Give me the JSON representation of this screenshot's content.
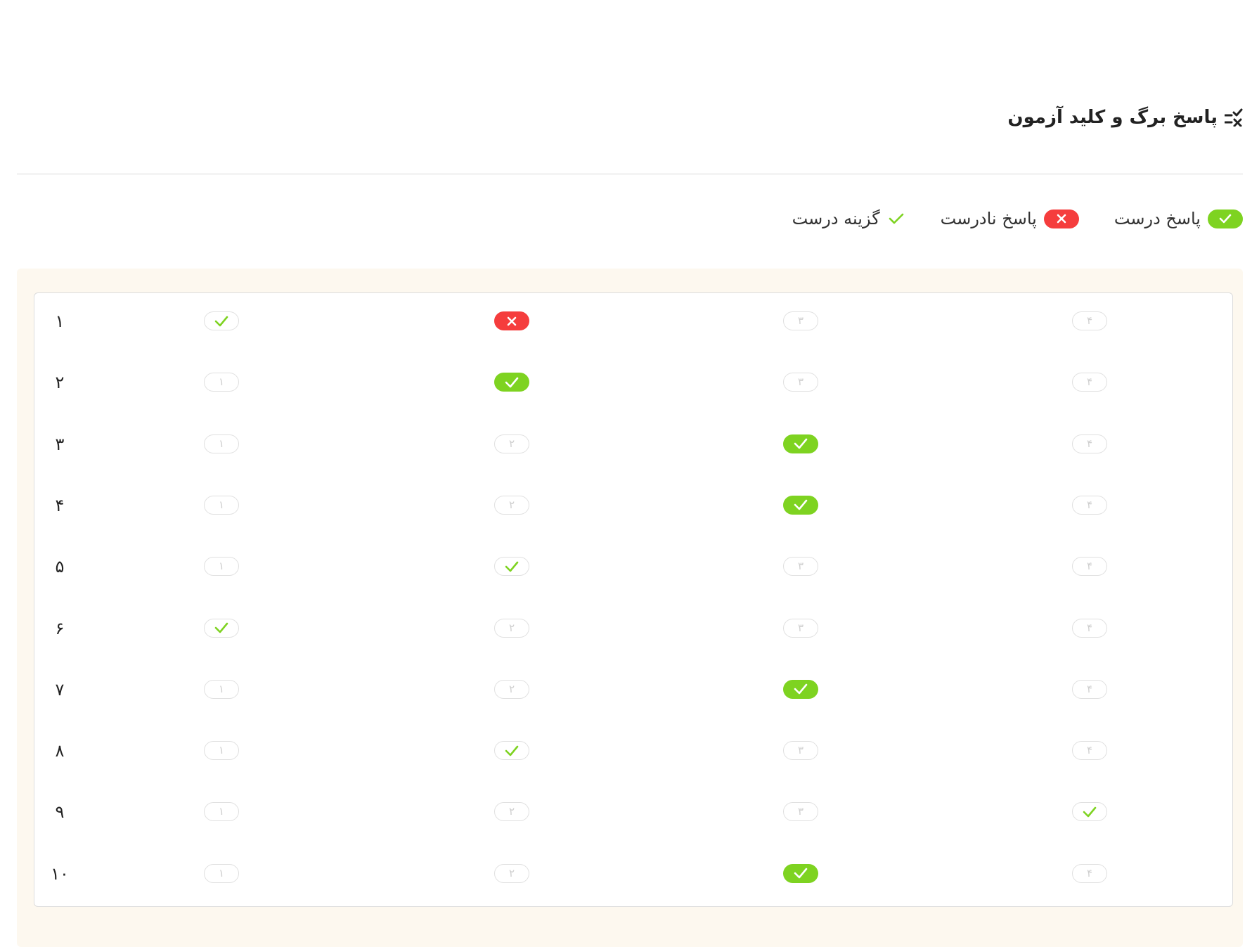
{
  "header": {
    "title": "پاسخ برگ و کلید آزمون",
    "icon": "checklist-icon"
  },
  "legend": [
    {
      "label": "پاسخ درست",
      "type": "correct"
    },
    {
      "label": "پاسخ نادرست",
      "type": "wrong"
    },
    {
      "label": "گزینه درست",
      "type": "key"
    }
  ],
  "colors": {
    "correct": "#7ed321",
    "wrong": "#f53d3d",
    "panel_bg": "#fdf8ef",
    "option_border": "#e0e0e0"
  },
  "answer_sheet": {
    "rows": [
      {
        "q": "۱",
        "options": [
          {
            "label": "۱",
            "state": "key"
          },
          {
            "label": "۲",
            "state": "wrong"
          },
          {
            "label": "۳",
            "state": "empty"
          },
          {
            "label": "۴",
            "state": "empty"
          }
        ]
      },
      {
        "q": "۲",
        "options": [
          {
            "label": "۱",
            "state": "empty"
          },
          {
            "label": "۲",
            "state": "correct"
          },
          {
            "label": "۳",
            "state": "empty"
          },
          {
            "label": "۴",
            "state": "empty"
          }
        ]
      },
      {
        "q": "۳",
        "options": [
          {
            "label": "۱",
            "state": "empty"
          },
          {
            "label": "۲",
            "state": "empty"
          },
          {
            "label": "۳",
            "state": "correct"
          },
          {
            "label": "۴",
            "state": "empty"
          }
        ]
      },
      {
        "q": "۴",
        "options": [
          {
            "label": "۱",
            "state": "empty"
          },
          {
            "label": "۲",
            "state": "empty"
          },
          {
            "label": "۳",
            "state": "correct"
          },
          {
            "label": "۴",
            "state": "empty"
          }
        ]
      },
      {
        "q": "۵",
        "options": [
          {
            "label": "۱",
            "state": "empty"
          },
          {
            "label": "۲",
            "state": "key"
          },
          {
            "label": "۳",
            "state": "empty"
          },
          {
            "label": "۴",
            "state": "empty"
          }
        ]
      },
      {
        "q": "۶",
        "options": [
          {
            "label": "۱",
            "state": "key"
          },
          {
            "label": "۲",
            "state": "empty"
          },
          {
            "label": "۳",
            "state": "empty"
          },
          {
            "label": "۴",
            "state": "empty"
          }
        ]
      },
      {
        "q": "۷",
        "options": [
          {
            "label": "۱",
            "state": "empty"
          },
          {
            "label": "۲",
            "state": "empty"
          },
          {
            "label": "۳",
            "state": "correct"
          },
          {
            "label": "۴",
            "state": "empty"
          }
        ]
      },
      {
        "q": "۸",
        "options": [
          {
            "label": "۱",
            "state": "empty"
          },
          {
            "label": "۲",
            "state": "key"
          },
          {
            "label": "۳",
            "state": "empty"
          },
          {
            "label": "۴",
            "state": "empty"
          }
        ]
      },
      {
        "q": "۹",
        "options": [
          {
            "label": "۱",
            "state": "empty"
          },
          {
            "label": "۲",
            "state": "empty"
          },
          {
            "label": "۳",
            "state": "empty"
          },
          {
            "label": "۴",
            "state": "key"
          }
        ]
      },
      {
        "q": "۱۰",
        "options": [
          {
            "label": "۱",
            "state": "empty"
          },
          {
            "label": "۲",
            "state": "empty"
          },
          {
            "label": "۳",
            "state": "correct"
          },
          {
            "label": "۴",
            "state": "empty"
          }
        ]
      }
    ]
  }
}
